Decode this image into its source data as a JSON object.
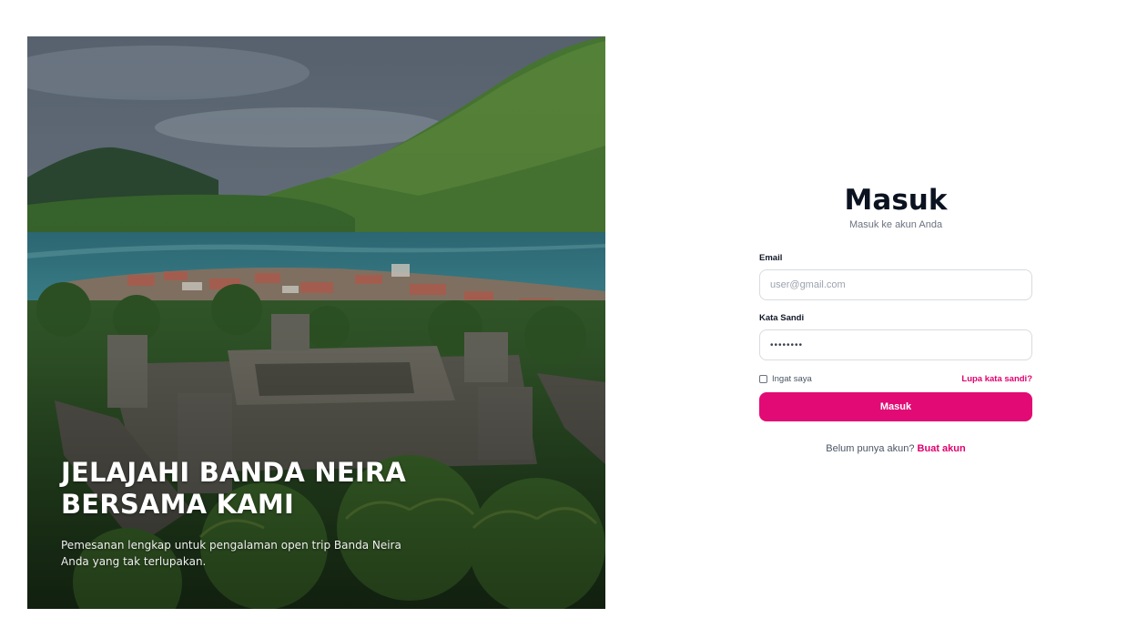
{
  "hero": {
    "title": "JELAJAHI BANDA NEIRA BERSAMA KAMI",
    "subtitle": "Pemesanan lengkap untuk pengalaman open trip Banda Neira Anda yang tak terlupakan.",
    "image_icon": "landscape-fort-photo"
  },
  "login": {
    "title": "Masuk",
    "subtitle": "Masuk ke akun Anda",
    "email_label": "Email",
    "email_placeholder": "user@gmail.com",
    "email_value": "",
    "password_label": "Kata Sandi",
    "password_value": "••••••••",
    "remember_label": "Ingat saya",
    "remember_checked": false,
    "forgot_label": "Lupa kata sandi?",
    "submit_label": "Masuk",
    "signup_prompt": "Belum punya akun?",
    "signup_link": "Buat akun"
  },
  "colors": {
    "accent": "#e20a74",
    "title": "#0b1220",
    "muted": "#6b7280"
  }
}
